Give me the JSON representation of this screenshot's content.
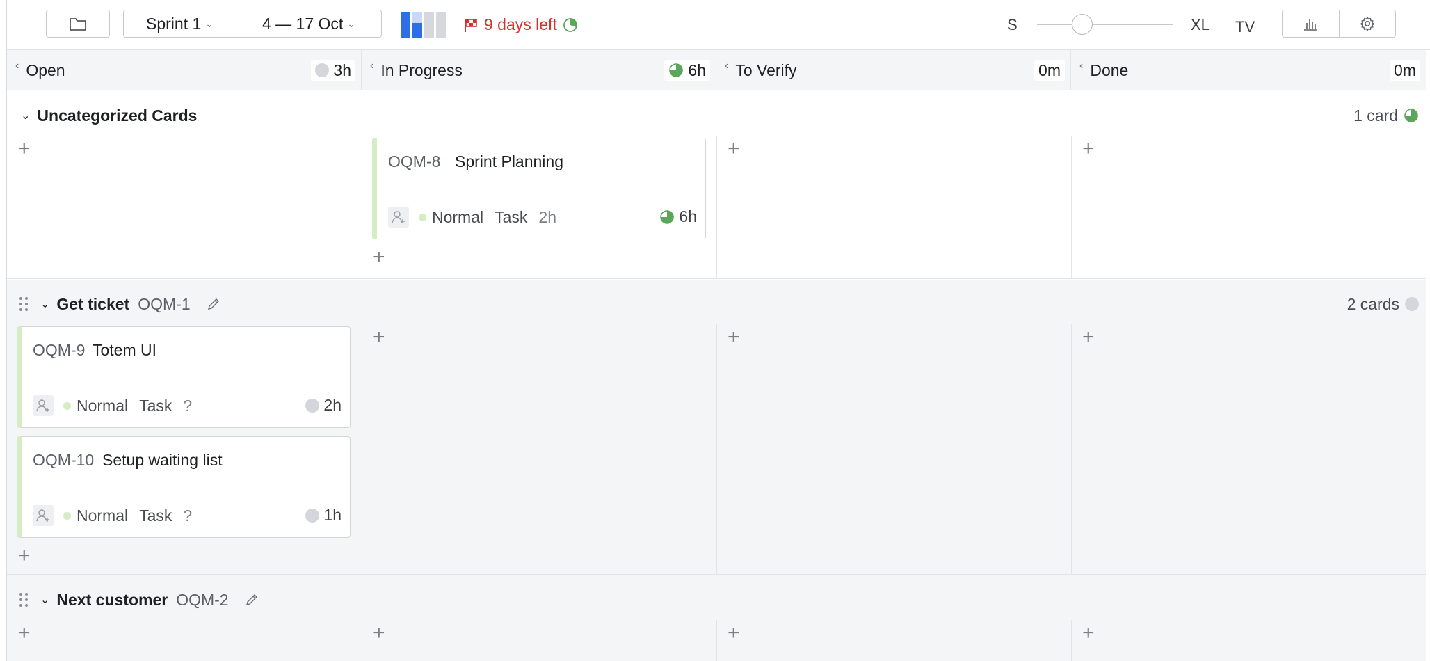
{
  "toolbar": {
    "sprint": "Sprint 1",
    "dates": "4 — 17 Oct",
    "days_left": "9 days left",
    "size_small": "S",
    "size_large": "XL",
    "tv_label": "TV"
  },
  "columns": [
    {
      "name": "Open",
      "estimate": "3h",
      "icon": "grey-circle-icon"
    },
    {
      "name": "In Progress",
      "estimate": "6h",
      "icon": "green-pie-icon"
    },
    {
      "name": "To Verify",
      "estimate": "0m",
      "icon": ""
    },
    {
      "name": "Done",
      "estimate": "0m",
      "icon": ""
    }
  ],
  "lanes": [
    {
      "name": "Uncategorized Cards",
      "key": "",
      "count": "1 card",
      "cards": [
        {
          "key": "OQM-8",
          "title": "Sprint Planning",
          "priority": "Normal",
          "type": "Task",
          "estimate": "2h",
          "spent": "6h",
          "column": 1
        }
      ]
    },
    {
      "name": "Get ticket",
      "key": "OQM-1",
      "count": "2 cards",
      "cards": [
        {
          "key": "OQM-9",
          "title": "Totem UI",
          "priority": "Normal",
          "type": "Task",
          "estimate": "?",
          "spent": "2h",
          "column": 0
        },
        {
          "key": "OQM-10",
          "title": "Setup waiting list",
          "priority": "Normal",
          "type": "Task",
          "estimate": "?",
          "spent": "1h",
          "column": 0
        }
      ]
    },
    {
      "name": "Next customer",
      "key": "OQM-2",
      "count": "",
      "cards": []
    }
  ],
  "colors": {
    "accent_blue": "#2f6fe6",
    "danger_red": "#d62f2f",
    "priority_green": "#d5ecc4",
    "progress_green": "#5aa65a"
  }
}
